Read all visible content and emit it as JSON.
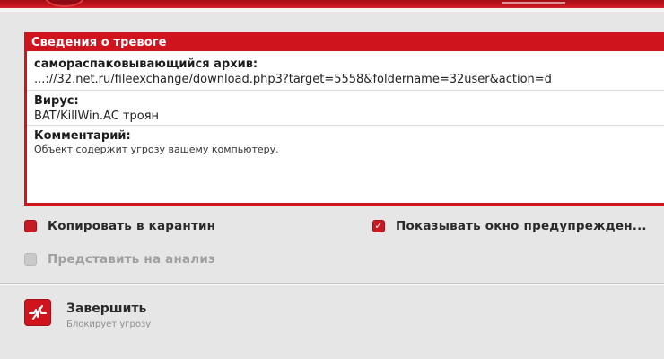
{
  "details": {
    "header": "Сведения о тревоге",
    "object_label": "самораспаковывающийся архив:",
    "object_value": "...://32.net.ru/fileexchange/download.php3?target=5558&foldername=32user&action=d",
    "virus_label": "Вирус:",
    "virus_value": "BAT/KillWin.AC троян",
    "comment_label": "Комментарий:",
    "comment_value": "Объект содержит угрозу вашему компьютеру."
  },
  "options": {
    "quarantine": {
      "label": "Копировать в карантин",
      "checked": false
    },
    "show_warning": {
      "label": "Показывать окно предупрежден...",
      "checked": true,
      "check_glyph": "✓"
    },
    "submit": {
      "label": "Представить на анализ",
      "enabled": false
    }
  },
  "action": {
    "title": "Завершить",
    "subtitle": "Блокирует угрозу",
    "icon": "terminate-icon"
  },
  "colors": {
    "accent_red": "#cf141d",
    "background": "#e6e6e6",
    "disabled": "#c9c9c9"
  }
}
